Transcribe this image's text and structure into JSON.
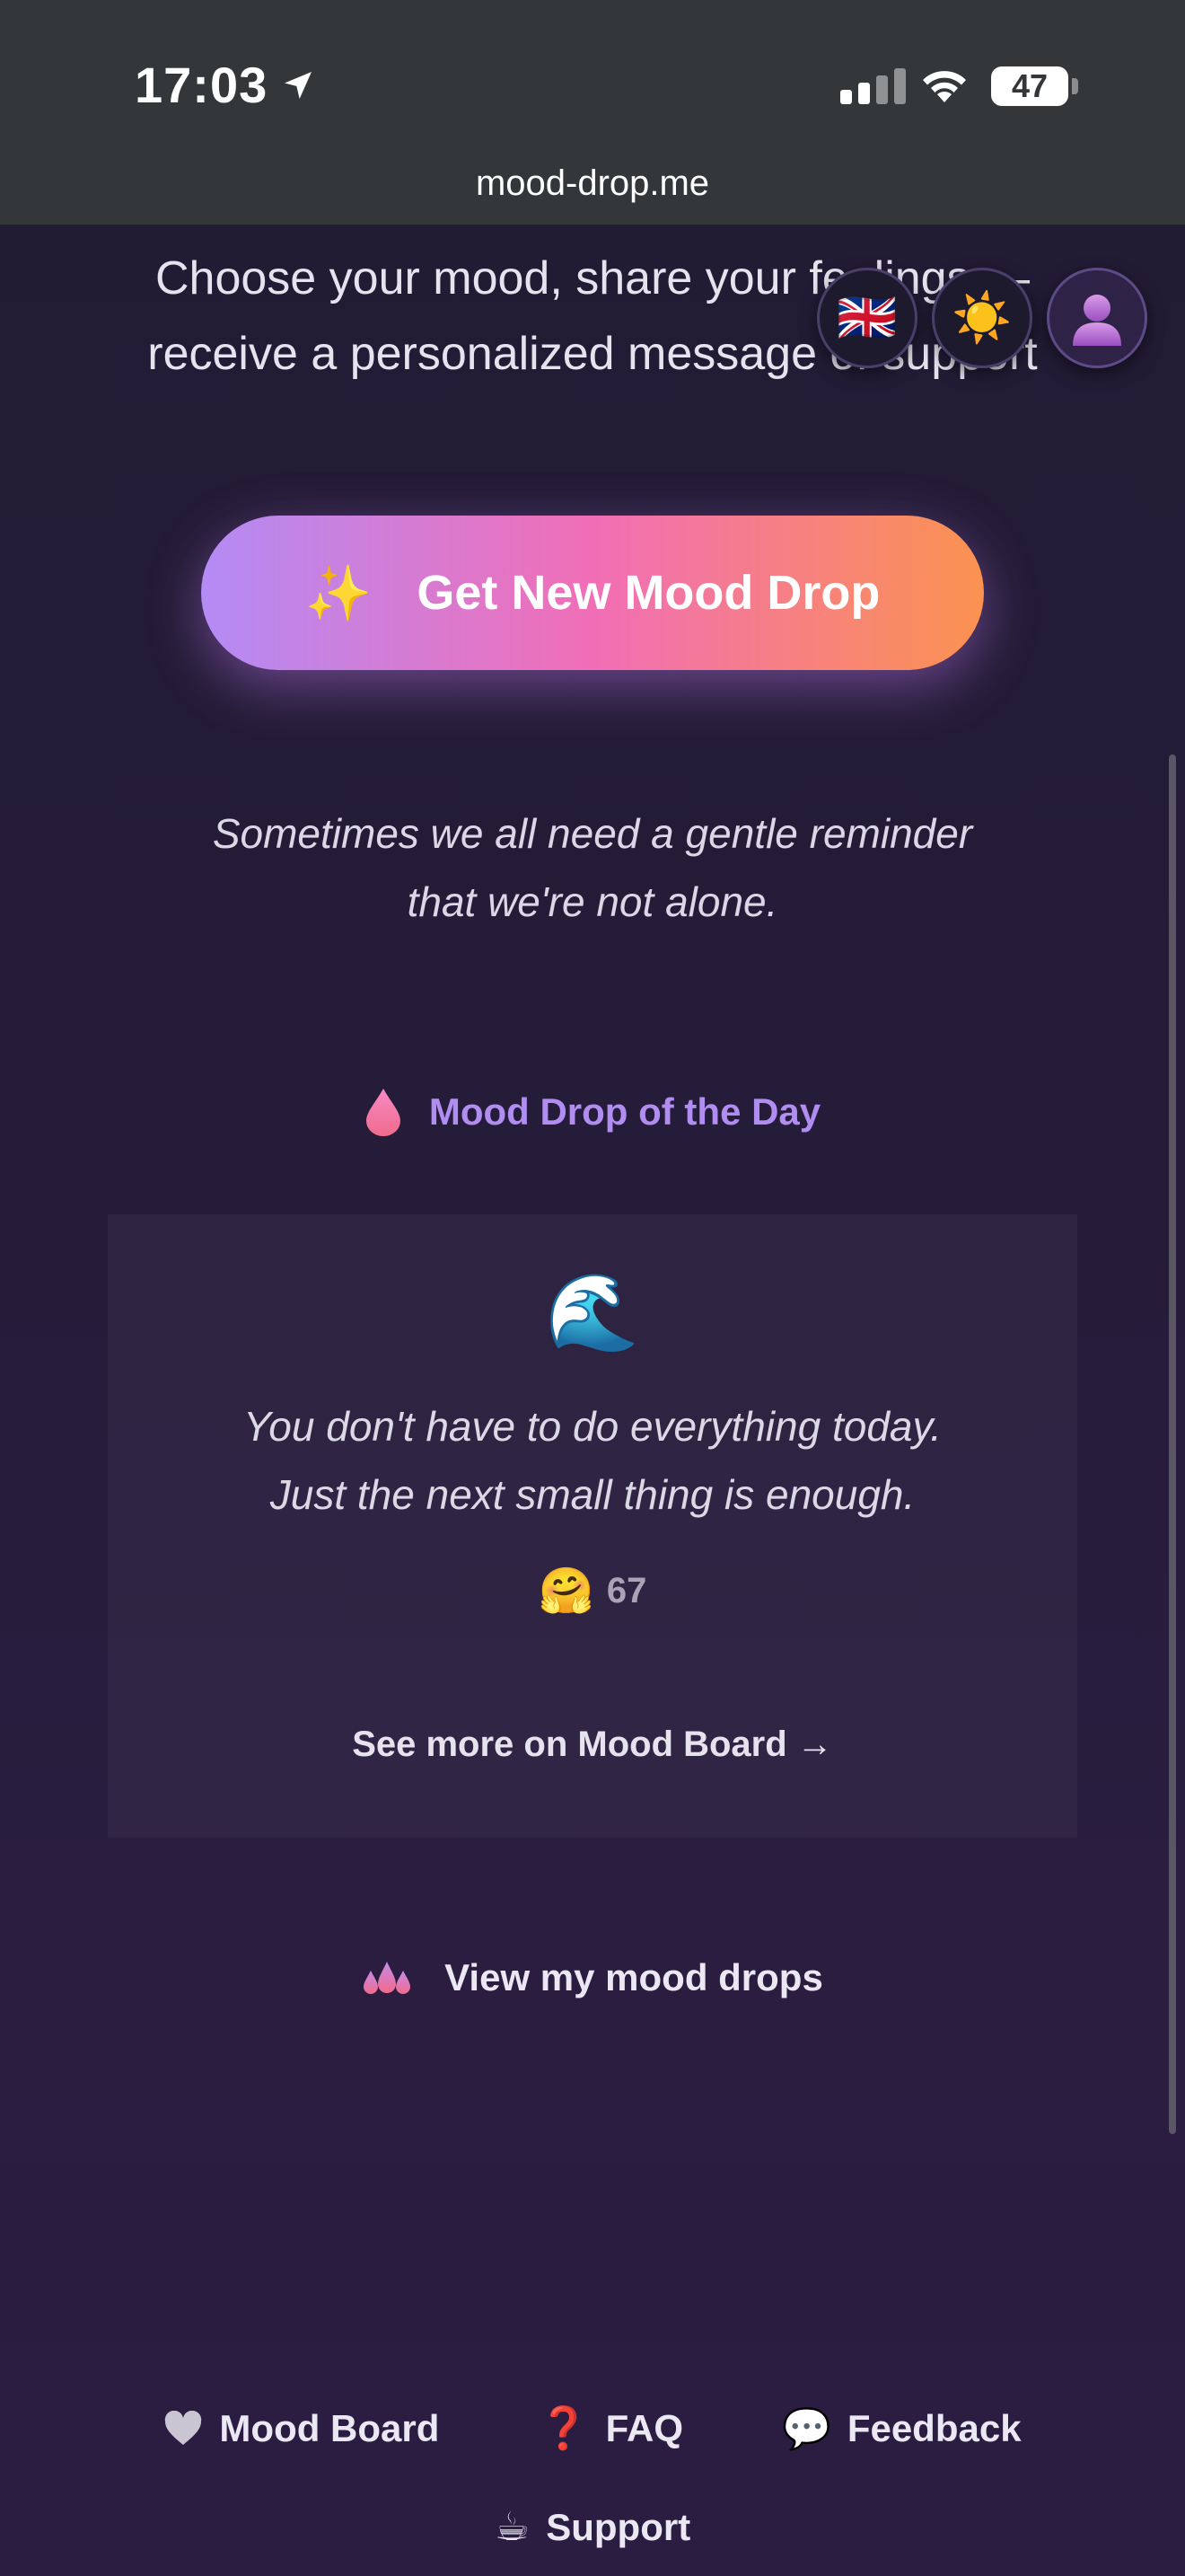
{
  "status_bar": {
    "time": "17:03",
    "battery": "47",
    "url": "mood-drop.me"
  },
  "intro": {
    "text": "Choose your mood, share your feelings — receive a personalized message of support"
  },
  "top_controls": {
    "language_flag": "🇬🇧",
    "theme": "☀️",
    "account": "👤"
  },
  "cta": {
    "icon": "✨",
    "label": "Get New Mood Drop"
  },
  "reminder": {
    "line1": "Sometimes we all need a gentle reminder",
    "line2": "that we're not alone."
  },
  "mood_of_day": {
    "title": "Mood Drop of the Day",
    "emoji": "🌊",
    "quote_line1": "You don't have to do everything today.",
    "quote_line2": "Just the next small thing is enough.",
    "reaction_emoji": "🤗",
    "reaction_count": "67",
    "link": "See more on Mood Board →"
  },
  "view_drops": {
    "label": "View my mood drops"
  },
  "footer": {
    "mood_board": "Mood Board",
    "faq": "FAQ",
    "feedback": "Feedback",
    "support": "Support",
    "support_icon": "☕",
    "feedback_icon": "💬",
    "faq_icon": "❓"
  },
  "colors": {
    "accent_purple": "#b18df2",
    "gradient_start": "#b48bf5",
    "gradient_mid": "#f16eb6",
    "gradient_end": "#fb9250"
  }
}
